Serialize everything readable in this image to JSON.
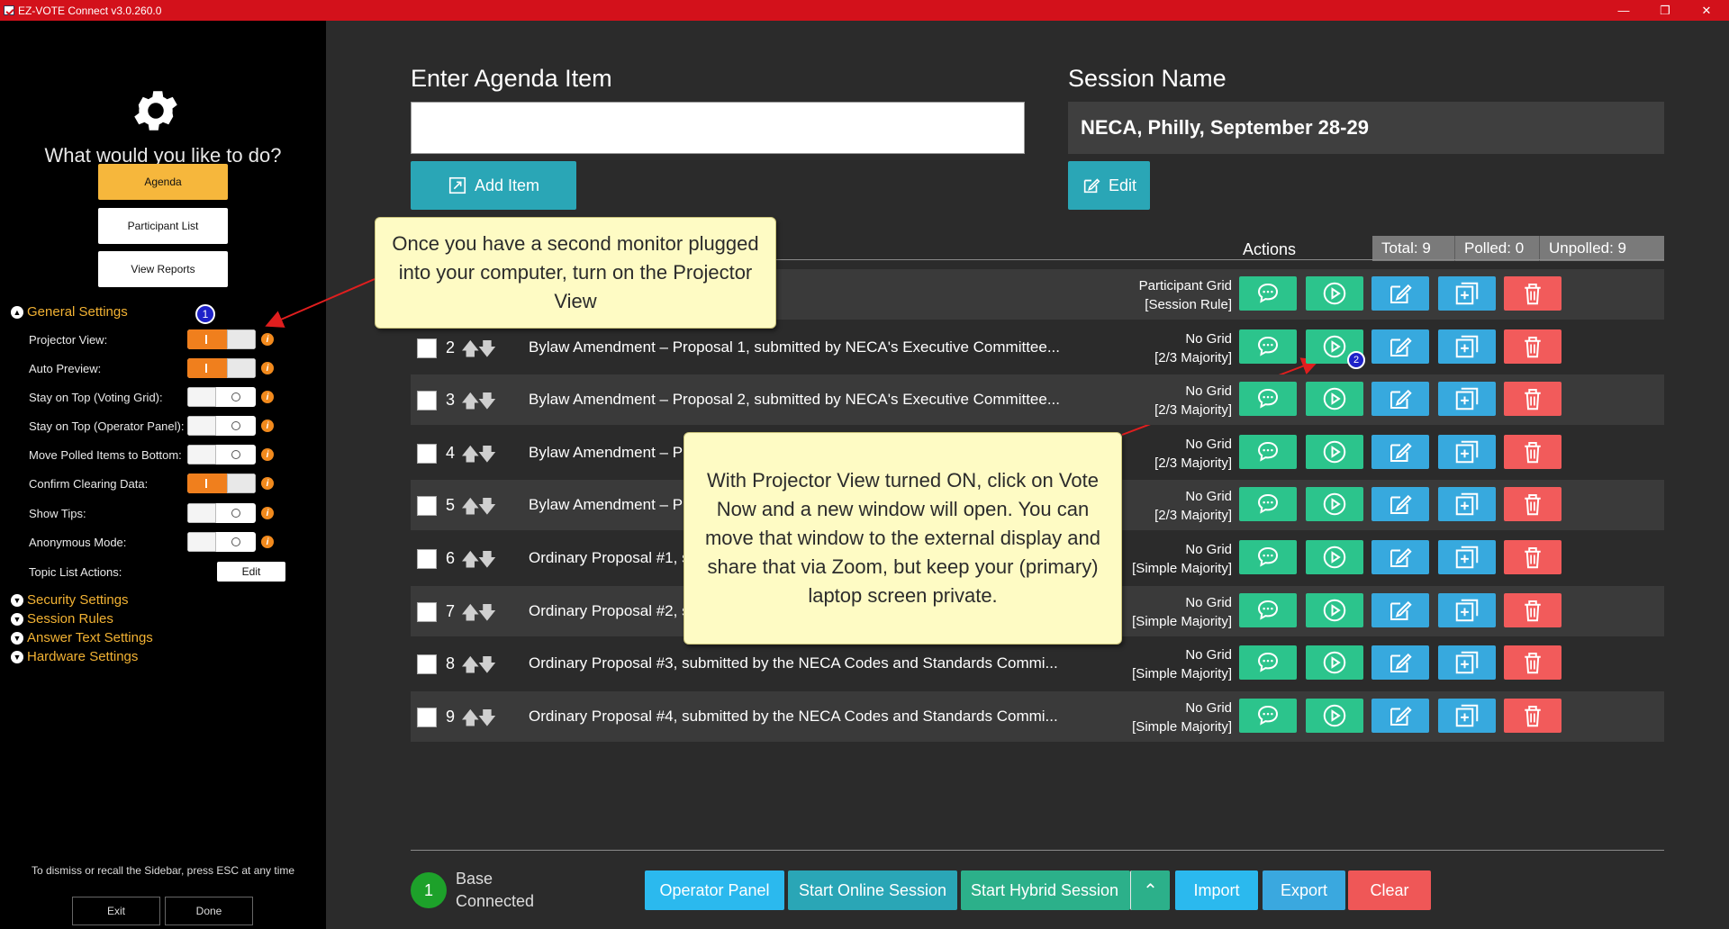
{
  "window": {
    "title": "EZ-VOTE Connect v3.0.260.0",
    "controls": [
      "—",
      "❐",
      "✕"
    ]
  },
  "sidebar": {
    "question": "What would you like to do?",
    "nav": [
      {
        "label": "Agenda",
        "active": true
      },
      {
        "label": "Participant List",
        "active": false
      },
      {
        "label": "View Reports",
        "active": false
      }
    ],
    "general_settings_label": "General Settings",
    "settings": [
      {
        "label": "Projector View:",
        "on": true
      },
      {
        "label": "Auto Preview:",
        "on": true
      },
      {
        "label": "Stay on Top (Voting Grid):",
        "on": false
      },
      {
        "label": "Stay on Top (Operator Panel):",
        "on": false
      },
      {
        "label": "Move Polled Items to Bottom:",
        "on": false
      },
      {
        "label": "Confirm Clearing Data:",
        "on": true
      },
      {
        "label": "Show Tips:",
        "on": false
      },
      {
        "label": "Anonymous Mode:",
        "on": false
      }
    ],
    "topic_list_label": "Topic List Actions:",
    "topic_list_button": "Edit",
    "sections": [
      "Security Settings",
      "Session Rules",
      "Answer Text Settings",
      "Hardware Settings"
    ],
    "hint": "To dismiss or recall the Sidebar, press ESC at any time",
    "exit_label": "Exit",
    "done_label": "Done",
    "marker_1": "1",
    "info_glyph": "i"
  },
  "agenda": {
    "heading": "Enter Agenda Item",
    "input_value": "",
    "add_label": "Add Item"
  },
  "session": {
    "heading": "Session Name",
    "name": "NECA, Philly, September 28-29",
    "edit_label": "Edit"
  },
  "table": {
    "actions_label": "Actions",
    "stats": {
      "total": "Total: 9",
      "polled": "Polled: 0",
      "unpolled": "Unpolled: 9"
    },
    "rows": [
      {
        "num": "",
        "title": "",
        "rule1": "Participant Grid",
        "rule2": "[Session Rule]",
        "has_checkbox": false
      },
      {
        "num": "2",
        "title": "Bylaw Amendment – Proposal 1, submitted by NECA's Executive Committee...",
        "rule1": "No Grid",
        "rule2": "[2/3 Majority]",
        "has_checkbox": true
      },
      {
        "num": "3",
        "title": "Bylaw Amendment – Proposal 2, submitted by NECA's Executive Committee...",
        "rule1": "No Grid",
        "rule2": "[2/3 Majority]",
        "has_checkbox": true
      },
      {
        "num": "4",
        "title": "Bylaw Amendment – Pr",
        "rule1": "No Grid",
        "rule2": "[2/3 Majority]",
        "has_checkbox": true
      },
      {
        "num": "5",
        "title": "Bylaw Amendment – Pr",
        "rule1": "No Grid",
        "rule2": "[2/3 Majority]",
        "has_checkbox": true
      },
      {
        "num": "6",
        "title": "Ordinary Proposal #1, s",
        "rule1": "No Grid",
        "rule2": "[Simple Majority]",
        "has_checkbox": true
      },
      {
        "num": "7",
        "title": "Ordinary Proposal #2, s",
        "rule1": "No Grid",
        "rule2": "[Simple Majority]",
        "has_checkbox": true
      },
      {
        "num": "8",
        "title": "Ordinary Proposal #3, submitted by the NECA Codes and Standards Commi...",
        "rule1": "No Grid",
        "rule2": "[Simple Majority]",
        "has_checkbox": true
      },
      {
        "num": "9",
        "title": "Ordinary Proposal #4, submitted by the NECA Codes and Standards Commi...",
        "rule1": "No Grid",
        "rule2": "[Simple Majority]",
        "has_checkbox": true
      }
    ],
    "marker_2": "2"
  },
  "callouts": {
    "first": "Once you have a second monitor plugged into your computer, turn on the Projector View",
    "second": "With Projector View turned ON, click on Vote Now and a new window will open. You can move that window to the external display and share that via Zoom, but keep your (primary) laptop screen private."
  },
  "footer": {
    "base_count": "1",
    "base_line1": "Base",
    "base_line2": "Connected",
    "buttons": {
      "operator": "Operator Panel",
      "online": "Start Online Session",
      "hybrid": "Start Hybrid Session",
      "hybrid_caret": "⌃",
      "import": "Import",
      "export": "Export",
      "clear": "Clear"
    }
  },
  "colors": {
    "titlebar": "#d3111b",
    "accent_orange": "#f6b73c",
    "teal": "#2aa6b6",
    "green_action": "#2cc48c",
    "blue_action": "#37a9de",
    "red_action": "#f25b5b",
    "callout": "#fefbc4"
  }
}
